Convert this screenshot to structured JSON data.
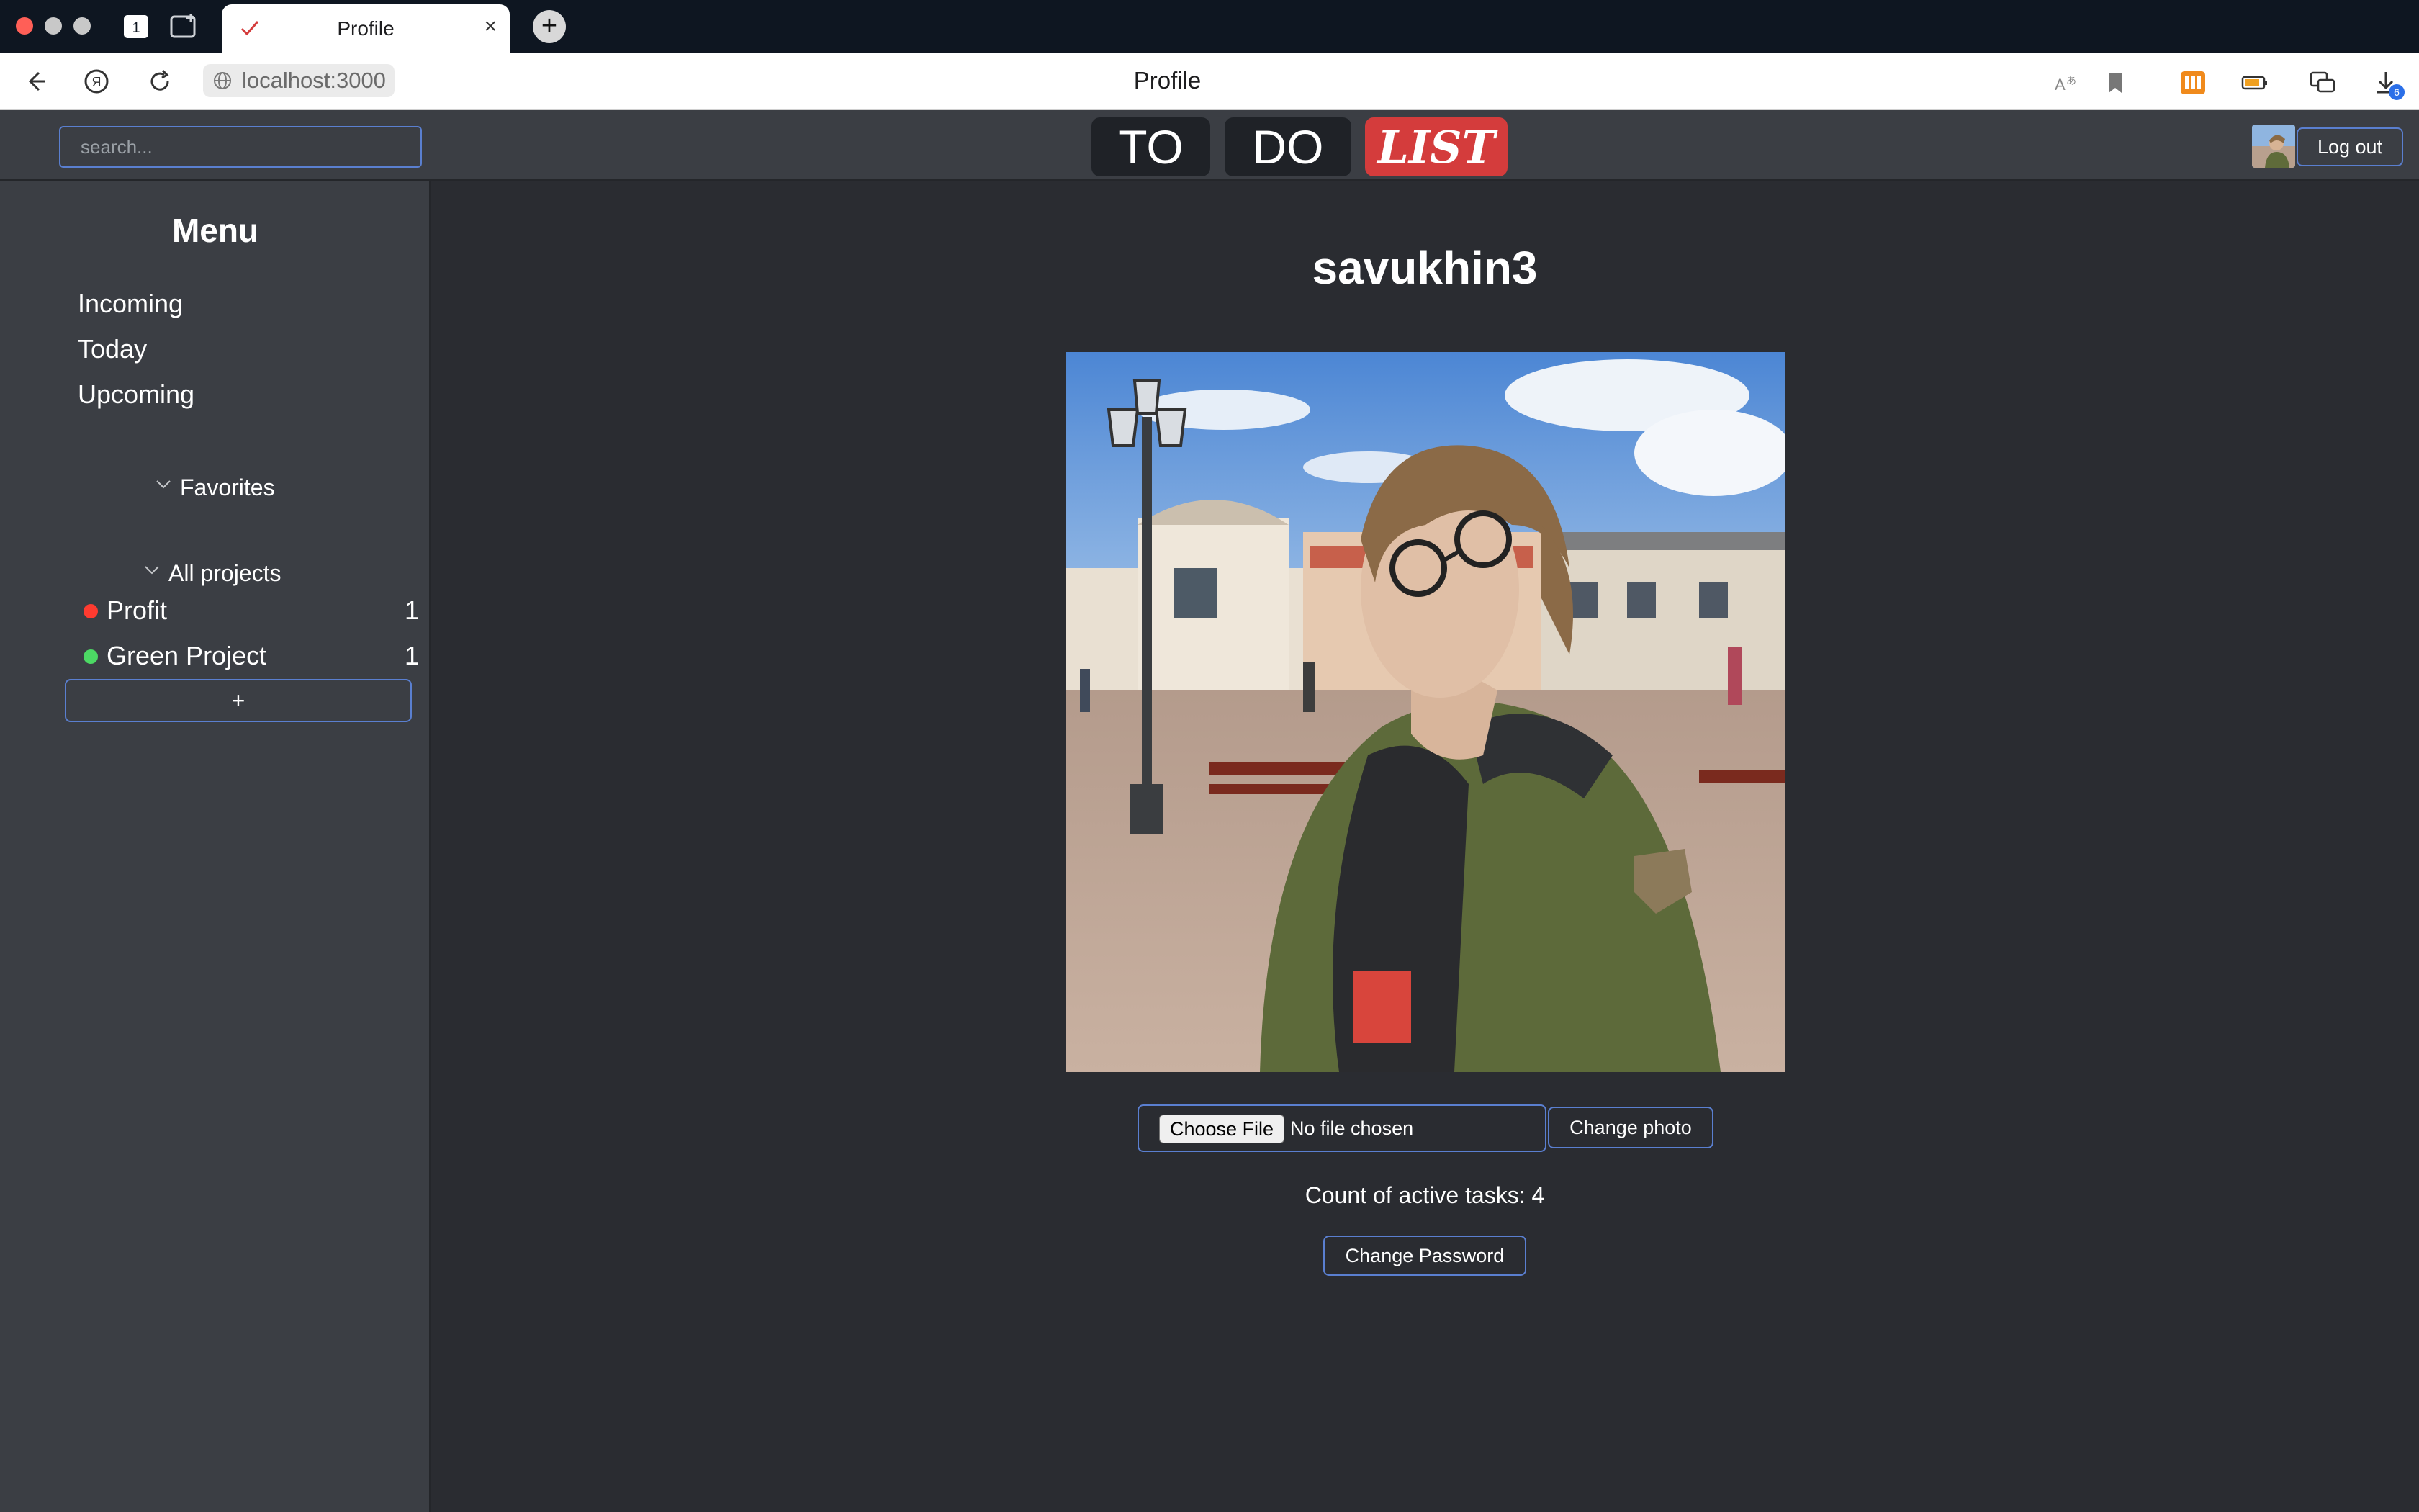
{
  "browser": {
    "tab_title": "Profile",
    "tab_close": "×",
    "new_tab": "+",
    "url": "localhost:3000",
    "page_title": "Profile",
    "downloads_badge": "6"
  },
  "header": {
    "search_placeholder": "search...",
    "logo": [
      "TO",
      "DO",
      "LIST"
    ],
    "logout_label": "Log out",
    "logo_list_color": "#d43c3c"
  },
  "sidebar": {
    "title": "Menu",
    "nav": [
      "Incoming",
      "Today",
      "Upcoming"
    ],
    "favorites_label": "Favorites",
    "all_projects_label": "All projects",
    "projects": [
      {
        "name": "Profit",
        "count": "1",
        "color": "#ff3b30"
      },
      {
        "name": "Green Project",
        "count": "1",
        "color": "#4cd964"
      }
    ],
    "add_label": "+"
  },
  "main": {
    "username": "savukhin3",
    "choose_file_label": "Choose File",
    "no_file_text": "No file chosen",
    "change_photo_label": "Change photo",
    "active_tasks_text": "Count of active tasks: 4",
    "change_password_label": "Change Password"
  },
  "colors": {
    "app_bg": "#2a2c31",
    "panel_bg": "#3b3e44",
    "accent_border": "#5a7fd0"
  }
}
